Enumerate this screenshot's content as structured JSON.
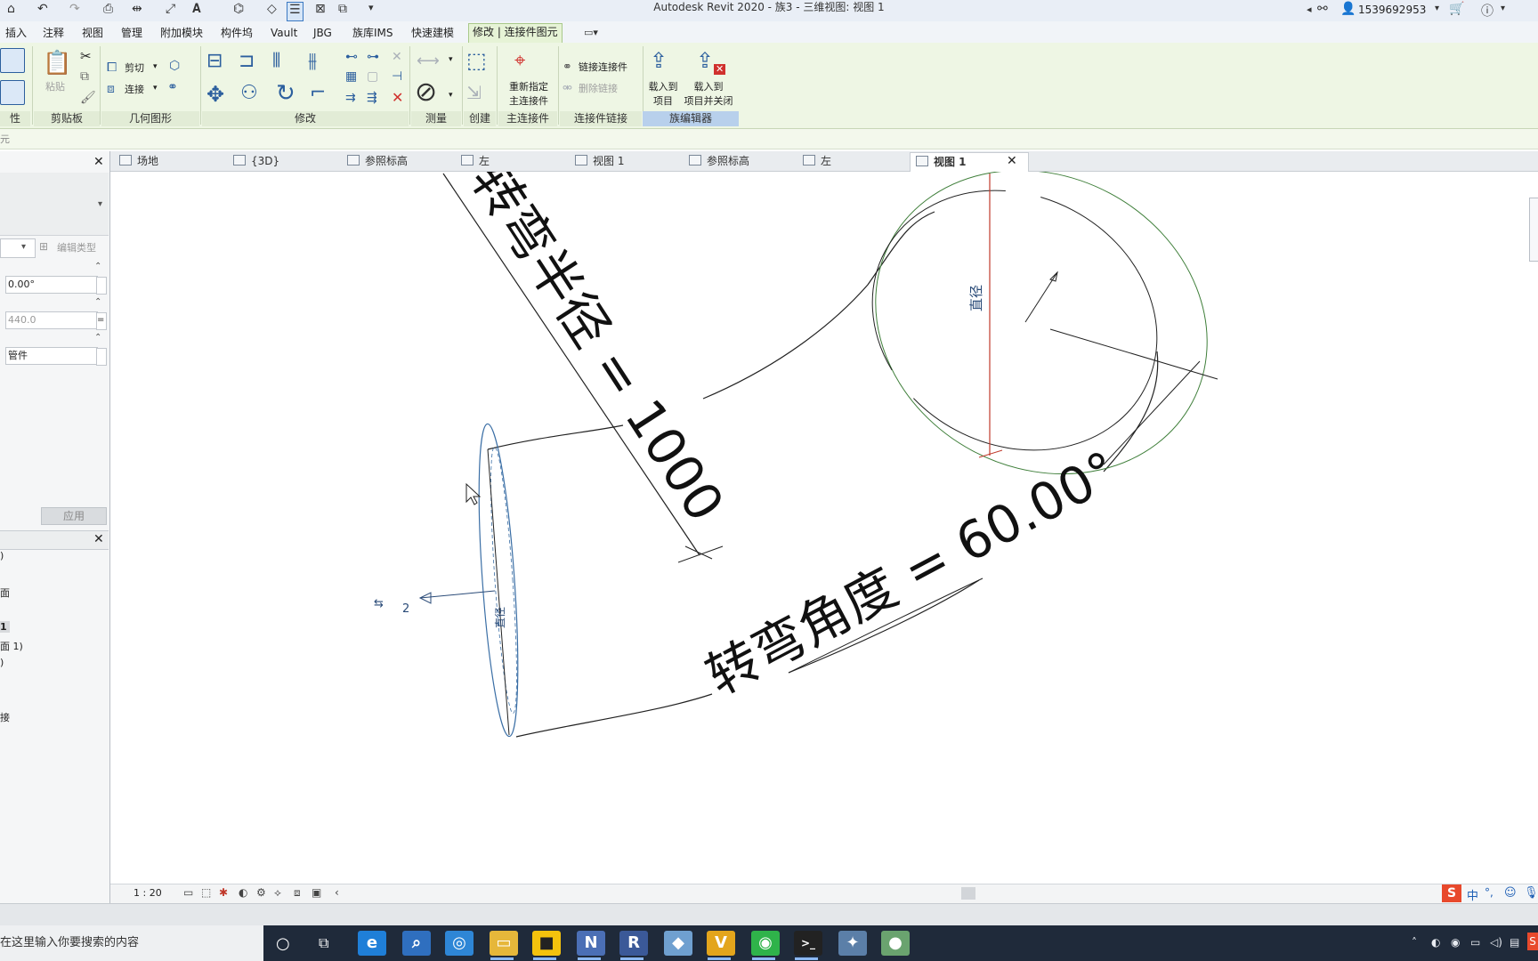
{
  "window": {
    "title": "Autodesk Revit 2020 - 族3 - 三维视图: 视图 1"
  },
  "account": {
    "user": "1539692953"
  },
  "ribbon_tabs": [
    {
      "label": "插入"
    },
    {
      "label": "注释"
    },
    {
      "label": "视图"
    },
    {
      "label": "管理"
    },
    {
      "label": "附加模块"
    },
    {
      "label": "构件坞"
    },
    {
      "label": "Vault"
    },
    {
      "label": "JBG"
    },
    {
      "label": "族库IMS"
    },
    {
      "label": "快速建模"
    },
    {
      "label": "修改 | 连接件图元"
    }
  ],
  "ribbon": {
    "panels": {
      "property": "性",
      "clipboard": "剪贴板",
      "geometry": "几何图形",
      "modify": "修改",
      "measure": "测量",
      "create": "创建",
      "host_connector": "主连接件",
      "connector_link": "连接件链接",
      "family_editor": "族编辑器"
    },
    "buttons": {
      "paste": "粘贴",
      "cut": "剪切",
      "join": "连接",
      "reassign_line1": "重新指定",
      "reassign_line2": "主连接件",
      "link_connector": "链接连接件",
      "remove_link": "删除链接",
      "load_project_line1": "载入到",
      "load_project_line2": "项目",
      "load_close_line1": "载入到",
      "load_close_line2": "项目并关闭"
    }
  },
  "option_bar": {
    "label": "元"
  },
  "view_tabs": [
    {
      "label": "场地"
    },
    {
      "label": "{3D}"
    },
    {
      "label": "参照标高"
    },
    {
      "label": "左"
    },
    {
      "label": "视图 1"
    },
    {
      "label": "参照标高"
    },
    {
      "label": "左"
    },
    {
      "label": "视图 1"
    }
  ],
  "properties": {
    "edit_type": "编辑类型",
    "angle_value": "0.00°",
    "length_value": "440.0",
    "category_value": "管件",
    "apply": "应用"
  },
  "browser": {
    "items": [
      ")",
      "面",
      "1",
      "面 1)",
      ")",
      "接"
    ]
  },
  "canvas": {
    "dim_radius": "转弯半径 = 1000",
    "dim_angle": "转弯角度 = 60.00°",
    "label_diameter": "直径",
    "label_diameter2": "直径",
    "axis_mark": "2"
  },
  "view_status": {
    "scale": "1 : 20"
  },
  "ime": {
    "mode": "中"
  },
  "taskbar": {
    "search_placeholder": "在这里输入你要搜索的内容",
    "apps": [
      {
        "name": "edge",
        "color": "#1f7fd8",
        "glyph": "e"
      },
      {
        "name": "search",
        "color": "#2f6fbf",
        "glyph": "⌕"
      },
      {
        "name": "browser",
        "color": "#2e86d6",
        "glyph": "◎"
      },
      {
        "name": "explorer",
        "color": "#e6b73a",
        "glyph": "▭"
      },
      {
        "name": "sticky",
        "color": "#f4c20d",
        "glyph": "■"
      },
      {
        "name": "onenote",
        "color": "#4b6fb5",
        "glyph": "N"
      },
      {
        "name": "revit",
        "color": "#3b5998",
        "glyph": "R"
      },
      {
        "name": "editor",
        "color": "#6fa0d0",
        "glyph": "◆"
      },
      {
        "name": "vault",
        "color": "#e3a51c",
        "glyph": "V"
      },
      {
        "name": "wechat",
        "color": "#2fb34a",
        "glyph": "◉"
      },
      {
        "name": "terminal",
        "color": "#222222",
        "glyph": ">_"
      },
      {
        "name": "tool",
        "color": "#5b7fa8",
        "glyph": "✦"
      },
      {
        "name": "app",
        "color": "#6aa36f",
        "glyph": "●"
      }
    ]
  }
}
